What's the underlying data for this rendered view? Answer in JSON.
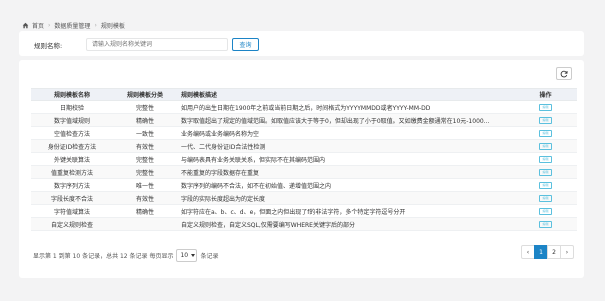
{
  "breadcrumb": {
    "home": "首页",
    "section": "数据质量管理",
    "current": "规则模板"
  },
  "search": {
    "label": "规则名称:",
    "placeholder": "请输入规则名称关键词",
    "button_label": "查询"
  },
  "table": {
    "columns": [
      "规则模板名称",
      "规则模板分类",
      "规则模板描述",
      "操作"
    ],
    "action_label": "编辑",
    "rows": [
      {
        "name": "日期校验",
        "category": "完整性",
        "desc": "如用户的出生日期在1900年之前或当前日期之后，时间格式为YYYYMMDD或者YYYY-MM-DD"
      },
      {
        "name": "数字值域规则",
        "category": "精确性",
        "desc": "数字取值超出了规定的值域范围。如取值应该大于等于0，但却出现了小于0取值。又如缴费金额通常在10元-1000..."
      },
      {
        "name": "空值检查方法",
        "category": "一致性",
        "desc": "业务编码或业务编码名称为空"
      },
      {
        "name": "身份证ID检查方法",
        "category": "有效性",
        "desc": "一代、二代身份证ID合法性检测"
      },
      {
        "name": "外键关联算法",
        "category": "完整性",
        "desc": "与编码表具有业务关联关系，但实际不在其编码范围内"
      },
      {
        "name": "值重复检测方法",
        "category": "完整性",
        "desc": "不能重复的字段数据存在重复"
      },
      {
        "name": "数字序列方法",
        "category": "唯一性",
        "desc": "数字序列的编码不合法，如不在初始值、递增值范围之内"
      },
      {
        "name": "字段长度不合法",
        "category": "有效性",
        "desc": "字段的实际长度超出为的定长度"
      },
      {
        "name": "字符值域算法",
        "category": "精确性",
        "desc": "如字符应在a、b、c、d、e，但面之内但出现了f的非法字符，多个特定字符逗号分开"
      },
      {
        "name": "自定义规则检查",
        "category": "",
        "desc": "自定义规则检查，自定义SQL,仅需要编写WHERE关键字后的部分"
      }
    ]
  },
  "pager": {
    "info": "显示第 1 到第 10 条记录，总共 12 条记录 每页显示",
    "page_size": "10",
    "suffix": "条记录",
    "prev": "‹",
    "next": "›",
    "pages": [
      "1",
      "2"
    ],
    "current_page": "1"
  }
}
